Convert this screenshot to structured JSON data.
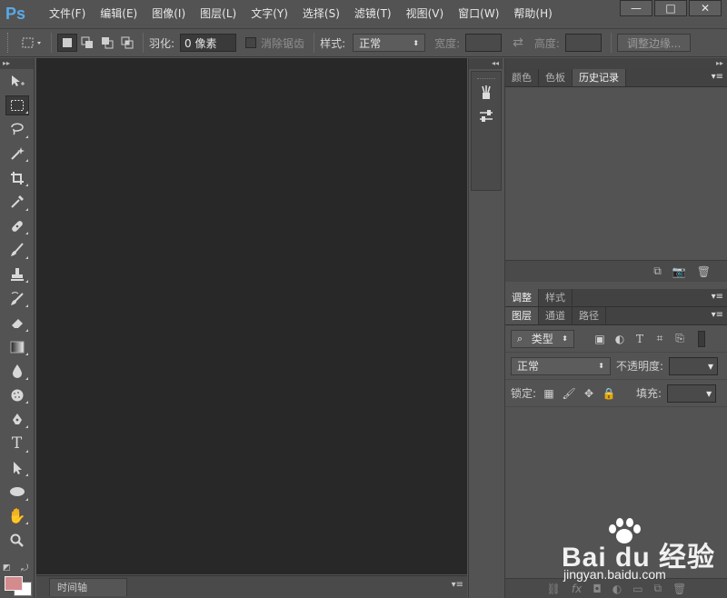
{
  "app": {
    "logo": "Ps"
  },
  "menubar": {
    "items": [
      "文件(F)",
      "编辑(E)",
      "图像(I)",
      "图层(L)",
      "文字(Y)",
      "选择(S)",
      "滤镜(T)",
      "视图(V)",
      "窗口(W)",
      "帮助(H)"
    ],
    "window_buttons": [
      "—",
      "□",
      "✕"
    ]
  },
  "options": {
    "feather_label": "羽化:",
    "feather_value": "0 像素",
    "antialias_label": "消除锯齿",
    "style_label": "样式:",
    "style_value": "正常",
    "width_label": "宽度:",
    "height_label": "高度:",
    "refine_edge": "调整边缘..."
  },
  "toolbar": {
    "tools": [
      "move-tool",
      "marquee-tool",
      "lasso-tool",
      "magic-wand-tool",
      "crop-tool",
      "eyedropper-tool",
      "healing-tool",
      "brush-tool",
      "stamp-tool",
      "history-brush-tool",
      "eraser-tool",
      "gradient-tool",
      "blur-tool",
      "dodge-tool",
      "pen-tool",
      "type-tool",
      "path-selection-tool",
      "ellipse-tool",
      "hand-tool",
      "zoom-tool"
    ],
    "foreground_color": "#d48b8e",
    "background_color": "#ffffff"
  },
  "timeline": {
    "tab": "时间轴"
  },
  "panels": {
    "top_tabs": [
      "颜色",
      "色板",
      "历史记录"
    ],
    "mid_tabs": [
      "调整",
      "样式"
    ],
    "layer_tabs": [
      "图层",
      "通道",
      "路径"
    ],
    "filter_label": "类型",
    "blend_mode": "正常",
    "opacity_label": "不透明度:",
    "lock_label": "锁定:",
    "fill_label": "填充:"
  },
  "watermark": {
    "brand": "Bai du 经验",
    "url": "jingyan.baidu.com"
  }
}
